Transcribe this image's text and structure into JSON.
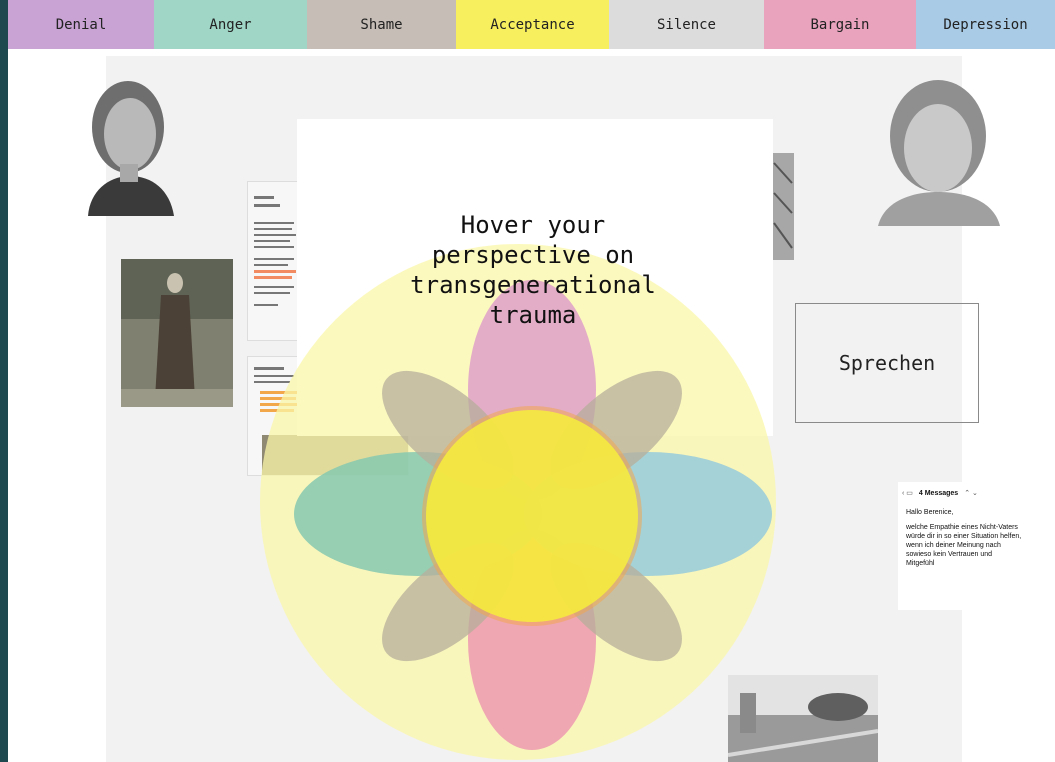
{
  "nav": {
    "tabs": [
      {
        "label": "Denial",
        "color": "#c9a3d4",
        "width": 146
      },
      {
        "label": "Anger",
        "color": "#9fd6c6",
        "width": 153
      },
      {
        "label": "Shame",
        "color": "#c6bdb6",
        "width": 149
      },
      {
        "label": "Acceptance",
        "color": "#f7ef5e",
        "width": 153
      },
      {
        "label": "Silence",
        "color": "#dcdcdc",
        "width": 155
      },
      {
        "label": "Bargain",
        "color": "#e9a3bd",
        "width": 152
      },
      {
        "label": "Depression",
        "color": "#a9cbe6",
        "width": 139
      }
    ]
  },
  "hero": {
    "line1": "Hover your",
    "line2": "perspective on",
    "line3": "transgenerational",
    "line4": "trauma"
  },
  "sprechen": {
    "label": "Sprechen"
  },
  "message": {
    "count": "4 Messages",
    "greeting": "Hallo Berenice,",
    "text": "welche Empathie eines Nicht-Vaters würde dir in so einer Situation helfen, wenn ich deiner Meinung nach sowieso kein Vertrauen und Mitgefühl"
  },
  "colors": {
    "yellow_circle": "#fbf7a8",
    "petal_pink": "#dea0c9",
    "petal_teal": "#85c8b0",
    "petal_blue": "#96cbdc",
    "petal_red": "#ed9fb0",
    "petal_taupe": "#b7ad9b",
    "center_yellow": "#f7ef3c",
    "ring_orange": "#f2a550"
  }
}
